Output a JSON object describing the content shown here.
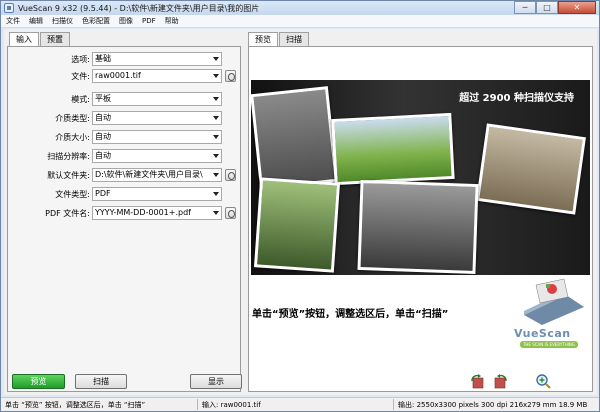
{
  "window": {
    "title": "VueScan 9 x32 (9.5.44) - D:\\软件\\新建文件夹\\用户目录\\我的图片",
    "minimize_glyph": "─",
    "maximize_glyph": "□",
    "close_glyph": "✕"
  },
  "menu": [
    "文件",
    "编辑",
    "扫描仪",
    "色彩配置",
    "图像",
    "PDF",
    "帮助"
  ],
  "left_tabs": [
    "输入",
    "预置"
  ],
  "right_tabs": [
    "预览",
    "扫描"
  ],
  "form": {
    "options": {
      "label": "选项:",
      "value": "基础"
    },
    "file": {
      "label": "文件:",
      "value": "raw0001.tif"
    },
    "mode": {
      "label": "模式:",
      "value": "平板"
    },
    "media_type": {
      "label": "介质类型:",
      "value": "自动"
    },
    "media_size": {
      "label": "介质大小:",
      "value": "自动"
    },
    "scan_resolution": {
      "label": "扫描分辨率:",
      "value": "自动"
    },
    "default_folder": {
      "label": "默认文件夹:",
      "value": "D:\\软件\\新建文件夹\\用户目录\\"
    },
    "file_type": {
      "label": "文件类型:",
      "value": "PDF"
    },
    "pdf_filename": {
      "label": "PDF 文件名:",
      "value": "YYYY-MM-DD-0001+.pdf"
    }
  },
  "preview": {
    "banner_text": "超过 2900 种扫描仪支持",
    "instruction": "单击“预览”按钮，调整选区后，单击“扫描”",
    "logo_text": "VueScan",
    "logo_tagline": "THE SCAN IS EVERYTHING"
  },
  "buttons": {
    "preview": "预览",
    "scan": "扫描",
    "show": "显示"
  },
  "status": {
    "hint": "单击 “预览” 按钮，调整选区后，单击 “扫描”",
    "input": "输入: raw0001.tif",
    "output": "输出: 2550x3300 pixels 300 dpi 216x279 mm 18.9 MB"
  },
  "colors": {
    "accent_green": "#2bb13a",
    "title_bar": "#c5d7ee",
    "logo_blue": "#6b8fb3",
    "logo_green": "#8fc24a"
  }
}
